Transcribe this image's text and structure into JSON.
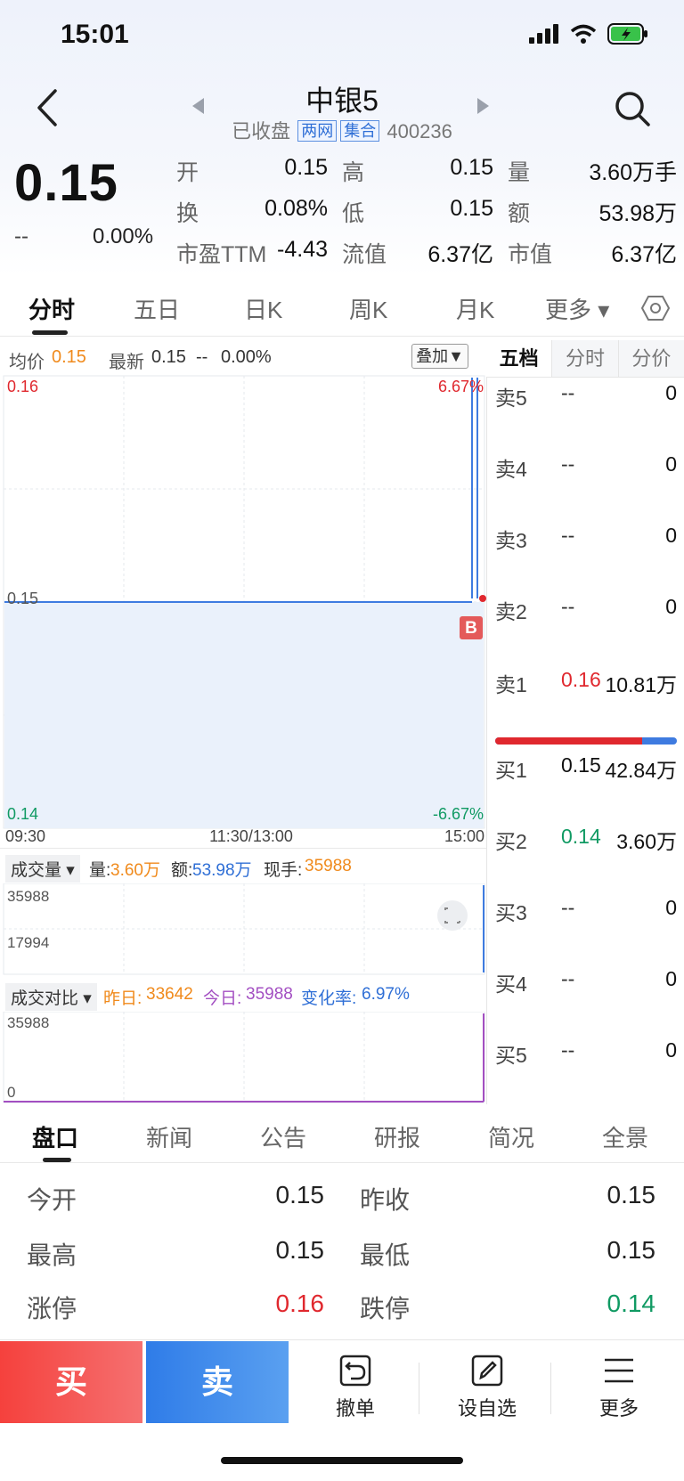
{
  "status_bar": {
    "time": "15:01"
  },
  "header": {
    "title": "中银5",
    "status": "已收盘",
    "tag1": "两网",
    "tag2": "集合",
    "code": "400236"
  },
  "price": {
    "last": "0.15",
    "change": "--",
    "change_pct": "0.00%"
  },
  "quote": {
    "open_label": "开",
    "open": "0.15",
    "high_label": "高",
    "high": "0.15",
    "vol_label": "量",
    "vol": "3.60万手",
    "turnover_label": "换",
    "turnover": "0.08%",
    "low_label": "低",
    "low": "0.15",
    "amount_label": "额",
    "amount": "53.98万",
    "pe_label": "市盈TTM",
    "pe": "-4.43",
    "float_cap_label": "流值",
    "float_cap": "6.37亿",
    "mkt_cap_label": "市值",
    "mkt_cap": "6.37亿"
  },
  "chart_tabs": [
    "分时",
    "五日",
    "日K",
    "周K",
    "月K",
    "更多 ▾"
  ],
  "chart_header": {
    "avg_label": "均价",
    "avg": "0.15",
    "latest_label": "最新",
    "latest": "0.15",
    "latest_chg": "--",
    "latest_pct": "0.00%",
    "overlay": "叠加▼"
  },
  "chart_data": [
    {
      "type": "line",
      "name": "分时",
      "x": [
        "09:30",
        "11:30/13:00",
        "15:00"
      ],
      "y_left_ticks": [
        "0.16",
        "0.15",
        "0.14"
      ],
      "y_right_ticks": [
        "6.67%",
        "-6.67%"
      ],
      "ylim": [
        0.14,
        0.16
      ],
      "series": [
        {
          "values": [
            0.15,
            0.15,
            0.15
          ]
        }
      ],
      "marker": "B",
      "colors": {
        "line": "#3e7be0",
        "fill": "#eaf1fb"
      }
    },
    {
      "type": "bar",
      "name": "成交量",
      "y_ticks": [
        "35988",
        "17994"
      ],
      "summary": {
        "vol_label": "量:",
        "vol": "3.60万",
        "amt_label": "额:",
        "amt": "53.98万",
        "hand_label": "现手:",
        "hand": "35988"
      }
    },
    {
      "type": "line",
      "name": "成交对比",
      "y_ticks": [
        "35988",
        "0"
      ],
      "summary": {
        "prev_label": "昨日:",
        "prev": "33642",
        "today_label": "今日:",
        "today": "35988",
        "rate_label": "变化率:",
        "rate": "6.97%"
      }
    }
  ],
  "sub1": {
    "label": "成交量 ▾"
  },
  "sub2": {
    "label": "成交对比 ▾"
  },
  "orderbook": {
    "tabs": [
      "五档",
      "分时",
      "分价"
    ],
    "asks": [
      {
        "label": "卖5",
        "price": "--",
        "vol": "0"
      },
      {
        "label": "卖4",
        "price": "--",
        "vol": "0"
      },
      {
        "label": "卖3",
        "price": "--",
        "vol": "0"
      },
      {
        "label": "卖2",
        "price": "--",
        "vol": "0"
      },
      {
        "label": "卖1",
        "price": "0.16",
        "vol": "10.81万"
      }
    ],
    "bids": [
      {
        "label": "买1",
        "price": "0.15",
        "vol": "42.84万"
      },
      {
        "label": "买2",
        "price": "0.14",
        "vol": "3.60万"
      },
      {
        "label": "买3",
        "price": "--",
        "vol": "0"
      },
      {
        "label": "买4",
        "price": "--",
        "vol": "0"
      },
      {
        "label": "买5",
        "price": "--",
        "vol": "0"
      }
    ],
    "ratio_red": 0.81
  },
  "bottom_tabs": [
    "盘口",
    "新闻",
    "公告",
    "研报",
    "简况",
    "全景"
  ],
  "panel": {
    "open_label": "今开",
    "open": "0.15",
    "prev_close_label": "昨收",
    "prev_close": "0.15",
    "high_label": "最高",
    "high": "0.15",
    "low_label": "最低",
    "low": "0.15",
    "limit_up_label": "涨停",
    "limit_up": "0.16",
    "limit_down_label": "跌停",
    "limit_down": "0.14"
  },
  "actions": {
    "buy": "买",
    "sell": "卖",
    "cancel": "撤单",
    "watchlist": "设自选",
    "more": "更多"
  },
  "colors": {
    "up": "#e0282e",
    "down": "#109a63",
    "accent": "#2f6fd6"
  }
}
